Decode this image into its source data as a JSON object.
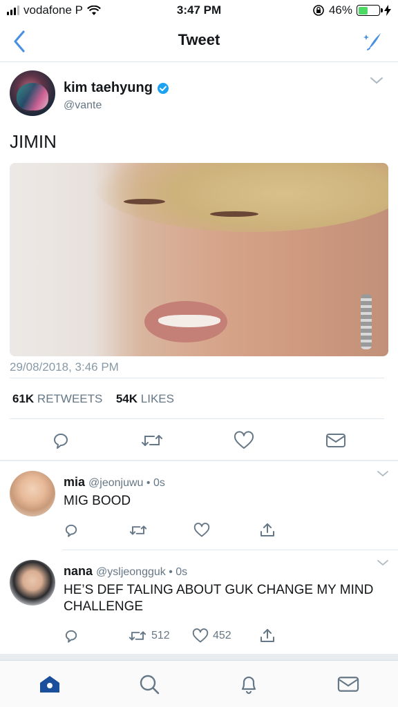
{
  "status_bar": {
    "carrier": "vodafone P",
    "time": "3:47 PM",
    "battery_percent": "46%",
    "battery_level": 0.46
  },
  "nav": {
    "title": "Tweet",
    "back_icon": "chevron-left-icon",
    "compose_icon": "sparkle-compose-icon"
  },
  "tweet": {
    "author_name": "kim taehyung",
    "author_handle": "@vante",
    "verified": true,
    "text": "JIMIN",
    "timestamp": "29/08/2018, 3:46 PM",
    "retweets_count": "61K",
    "retweets_label": "RETWEETS",
    "likes_count": "54K",
    "likes_label": "LIKES"
  },
  "replies": [
    {
      "name": "mia",
      "meta": "@jeonjuwu • 0s",
      "text": "MIG BOOD",
      "retweets": "",
      "likes": ""
    },
    {
      "name": "nana",
      "meta": "@ysljeongguk • 0s",
      "text": "HE’S DEF TALING ABOUT GUK CHANGE MY MIND CHALLENGE",
      "retweets": "512",
      "likes": "452"
    }
  ],
  "colors": {
    "accent": "#1da1f2",
    "nav_blue": "#4a7fc1",
    "muted": "#657786",
    "icon_gray": "#657786"
  }
}
